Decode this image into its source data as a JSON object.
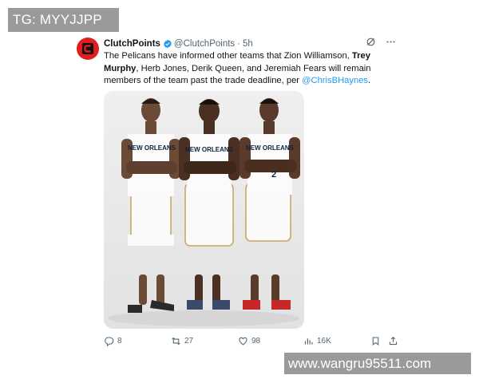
{
  "overlays": {
    "top_text": "TG: MYYJJPP",
    "bottom_text": "www.wangru95511.com"
  },
  "tweet": {
    "author": {
      "name": "ClutchPoints",
      "handle": "@ClutchPoints",
      "separator": "·",
      "time": "5h",
      "avatar_letter_icon": "clutchpoints-c-logo"
    },
    "text": {
      "part1": "The Pelicans have informed other teams that Zion Williamson, ",
      "bold_name": "Trey Murphy",
      "part2": ", Herb Jones, Derik Queen, and Jeremiah Fears will remain members of the team past the trade deadline, per ",
      "mention": "@ChrisBHaynes",
      "part3": "."
    },
    "photo": {
      "jersey_text": "NEW ORLEANS",
      "jersey_numbers": [
        "",
        "",
        "2"
      ]
    },
    "actions": {
      "replies": "8",
      "reposts": "27",
      "likes": "98",
      "views": "16K"
    },
    "colors": {
      "accent": "#1d9bf0",
      "avatar_bg": "#e11d1d",
      "text": "#0f1419",
      "muted": "#536471"
    }
  }
}
